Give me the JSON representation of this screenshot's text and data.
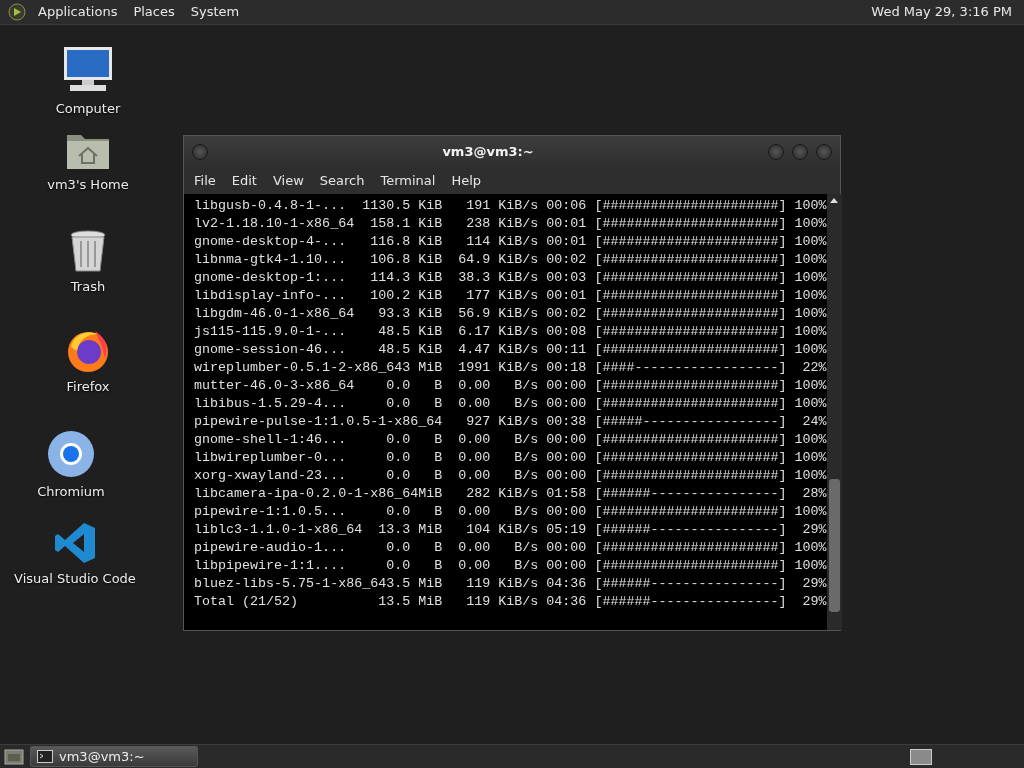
{
  "top_panel": {
    "menus": [
      "Applications",
      "Places",
      "System"
    ],
    "clock": "Wed May 29,  3:16 PM"
  },
  "desktop_icons": [
    {
      "label": "Computer",
      "kind": "computer"
    },
    {
      "label": "vm3's Home",
      "kind": "home"
    },
    {
      "label": "Trash",
      "kind": "trash"
    },
    {
      "label": "Firefox",
      "kind": "firefox"
    },
    {
      "label": "Chromium",
      "kind": "chromium"
    },
    {
      "label": "Visual Studio Code",
      "kind": "vscode"
    }
  ],
  "terminal": {
    "title": "vm3@vm3:~",
    "menus": [
      "File",
      "Edit",
      "View",
      "Search",
      "Terminal",
      "Help"
    ],
    "lines": [
      "libgusb-0.4.8-1-...  1130.5 KiB   191 KiB/s 00:06 [######################] 100%",
      "lv2-1.18.10-1-x86_64  158.1 KiB   238 KiB/s 00:01 [######################] 100%",
      "gnome-desktop-4-...   116.8 KiB   114 KiB/s 00:01 [######################] 100%",
      "libnma-gtk4-1.10...   106.8 KiB  64.9 KiB/s 00:02 [######################] 100%",
      "gnome-desktop-1:...   114.3 KiB  38.3 KiB/s 00:03 [######################] 100%",
      "libdisplay-info-...   100.2 KiB   177 KiB/s 00:01 [######################] 100%",
      "libgdm-46.0-1-x86_64   93.3 KiB  56.9 KiB/s 00:02 [######################] 100%",
      "js115-115.9.0-1-...    48.5 KiB  6.17 KiB/s 00:08 [######################] 100%",
      "gnome-session-46...    48.5 KiB  4.47 KiB/s 00:11 [######################] 100%",
      "wireplumber-0.5.1-2-x86_643 MiB  1991 KiB/s 00:18 [####------------------]  22%",
      "mutter-46.0-3-x86_64    0.0   B  0.00   B/s 00:00 [######################] 100%",
      "libibus-1.5.29-4...     0.0   B  0.00   B/s 00:00 [######################] 100%",
      "pipewire-pulse-1:1.0.5-1-x86_64   927 KiB/s 00:38 [#####-----------------]  24%",
      "gnome-shell-1:46...     0.0   B  0.00   B/s 00:00 [######################] 100%",
      "libwireplumber-0...     0.0   B  0.00   B/s 00:00 [######################] 100%",
      "xorg-xwayland-23...     0.0   B  0.00   B/s 00:00 [######################] 100%",
      "libcamera-ipa-0.2.0-1-x86_64MiB   282 KiB/s 01:58 [######----------------]  28%",
      "pipewire-1:1.0.5...     0.0   B  0.00   B/s 00:00 [######################] 100%",
      "liblc3-1.1.0-1-x86_64  13.3 MiB   104 KiB/s 05:19 [######----------------]  29%",
      "pipewire-audio-1...     0.0   B  0.00   B/s 00:00 [######################] 100%",
      "libpipewire-1:1....     0.0   B  0.00   B/s 00:00 [######################] 100%",
      "bluez-libs-5.75-1-x86_643.5 MiB   119 KiB/s 04:36 [######----------------]  29%",
      "Total (21/52)          13.5 MiB   119 KiB/s 04:36 [######----------------]  29%"
    ]
  },
  "taskbar": {
    "tasks": [
      {
        "label": "vm3@vm3:~",
        "selected": true
      }
    ]
  }
}
